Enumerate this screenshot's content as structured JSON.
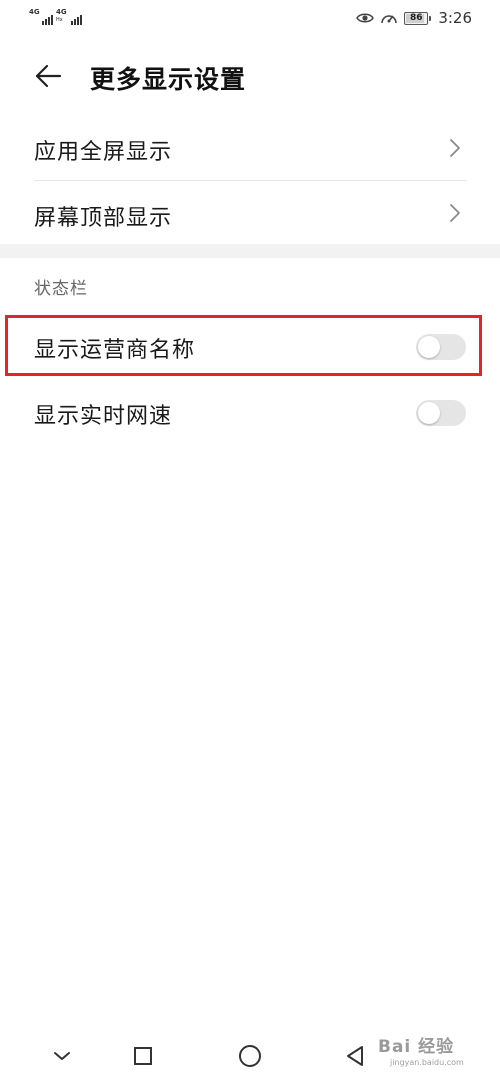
{
  "status_bar": {
    "sim1_network": "4G",
    "sim2_network": "4G",
    "sim2_sub": "Hx",
    "battery": "86",
    "time": "3:26"
  },
  "header": {
    "title": "更多显示设置"
  },
  "settings": {
    "items": [
      {
        "label": "应用全屏显示"
      },
      {
        "label": "屏幕顶部显示"
      }
    ],
    "section_title": "状态栏",
    "toggles": [
      {
        "label": "显示运营商名称",
        "on": false
      },
      {
        "label": "显示实时网速",
        "on": false
      }
    ]
  },
  "colors": {
    "highlight": "#e0262a",
    "toggle_off": "#e5e5e5"
  },
  "watermark": {
    "text": "Bai 经验",
    "sub": "jingyan.baidu.com"
  }
}
